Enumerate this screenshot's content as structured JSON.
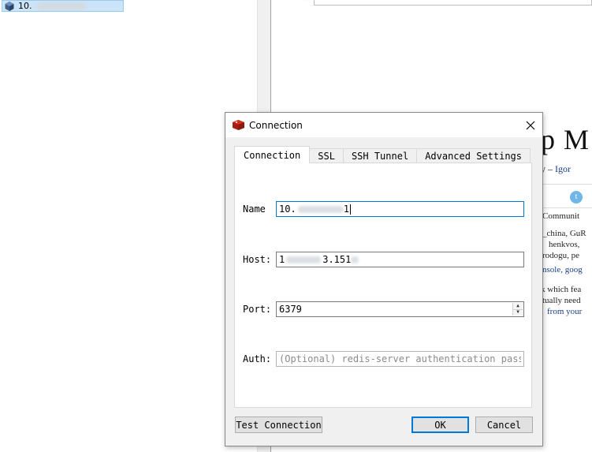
{
  "tree": {
    "selected_item_label": "10."
  },
  "background_page": {
    "heading": "p M",
    "author_prefix": "y – ",
    "author_link": "Igor",
    "twitter_glyph": "t",
    "lines": [
      {
        "text": "Communit",
        "style": "plain"
      },
      {
        "text": "_china, GuR",
        "style": "plain"
      },
      {
        "text": "henkvos,",
        "style": "plain"
      },
      {
        "text": "rodogu, pe",
        "style": "plain"
      },
      {
        "text": "nsole, goog",
        "style": "blue"
      },
      {
        "text": "k which fea",
        "style": "plain"
      },
      {
        "text": "tually need",
        "style": "plain"
      },
      {
        "text": "from your",
        "style": "blue"
      }
    ]
  },
  "dialog": {
    "title": "Connection",
    "tabs": [
      {
        "label": "Connection",
        "active": true
      },
      {
        "label": "SSL",
        "active": false
      },
      {
        "label": "SSH Tunnel",
        "active": false
      },
      {
        "label": "Advanced Settings",
        "active": false
      }
    ],
    "form": {
      "name_label": "Name",
      "name_value": "10.",
      "name_value_tail": "1",
      "host_label": "Host:",
      "host_value_prefix": "1",
      "host_value_tail": "3.151",
      "port_label": "Port:",
      "port_value": "6379",
      "auth_label": "Auth:",
      "auth_placeholder": "(Optional) redis-server authentication password"
    },
    "buttons": {
      "test_connection": "Test Connection",
      "ok": "OK",
      "cancel": "Cancel"
    }
  },
  "colors": {
    "selection": "#cce4f7",
    "focus_border": "#0078d7",
    "redis_red": "#d82c20",
    "link_blue": "#1a3c8a"
  }
}
